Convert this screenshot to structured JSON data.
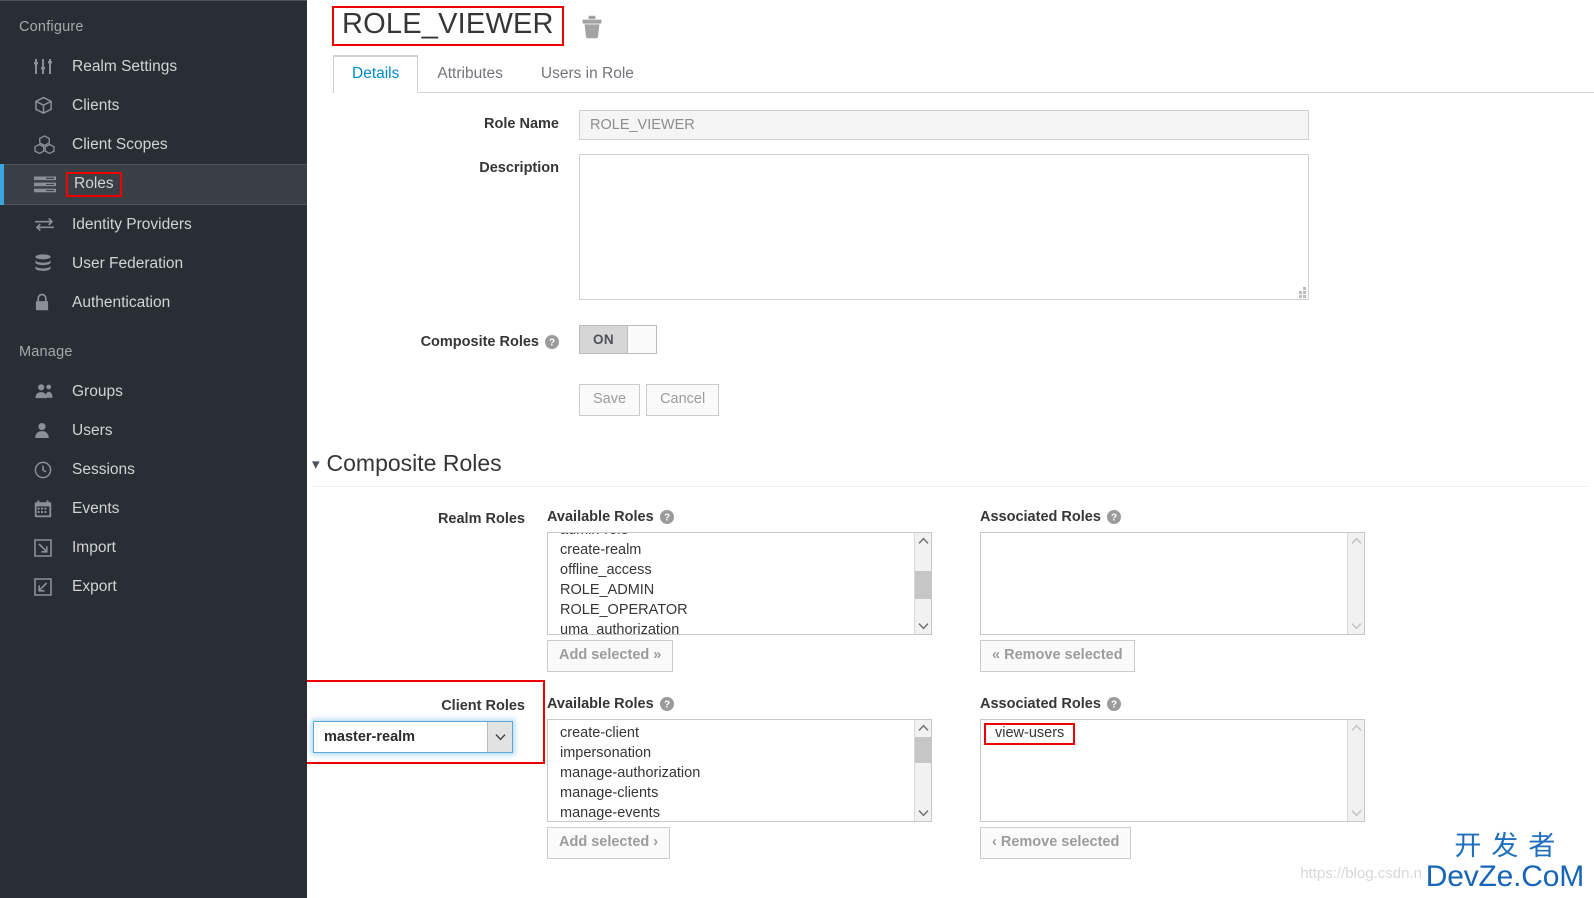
{
  "sidebar": {
    "groups": [
      {
        "title": "Configure",
        "items": [
          {
            "label": "Realm Settings",
            "icon": "sliders-icon",
            "active": false
          },
          {
            "label": "Clients",
            "icon": "cube-icon",
            "active": false
          },
          {
            "label": "Client Scopes",
            "icon": "cubes-icon",
            "active": false
          },
          {
            "label": "Roles",
            "icon": "list-rows-icon",
            "active": true
          },
          {
            "label": "Identity Providers",
            "icon": "exchange-icon",
            "active": false
          },
          {
            "label": "User Federation",
            "icon": "database-icon",
            "active": false
          },
          {
            "label": "Authentication",
            "icon": "lock-icon",
            "active": false
          }
        ]
      },
      {
        "title": "Manage",
        "items": [
          {
            "label": "Groups",
            "icon": "users-icon",
            "active": false
          },
          {
            "label": "Users",
            "icon": "user-icon",
            "active": false
          },
          {
            "label": "Sessions",
            "icon": "clock-icon",
            "active": false
          },
          {
            "label": "Events",
            "icon": "calendar-icon",
            "active": false
          },
          {
            "label": "Import",
            "icon": "import-arrow-icon",
            "active": false
          },
          {
            "label": "Export",
            "icon": "export-arrow-icon",
            "active": false
          }
        ]
      }
    ]
  },
  "header": {
    "title": "ROLE_VIEWER",
    "delete_icon": "trash-icon"
  },
  "tabs": [
    {
      "label": "Details",
      "active": true
    },
    {
      "label": "Attributes",
      "active": false
    },
    {
      "label": "Users in Role",
      "active": false
    }
  ],
  "details": {
    "role_name_label": "Role Name",
    "role_name_value": "ROLE_VIEWER",
    "description_label": "Description",
    "description_value": "",
    "composite_label": "Composite Roles",
    "composite_toggle_state": "ON",
    "save_label": "Save",
    "cancel_label": "Cancel"
  },
  "composite_section": {
    "title": "Composite Roles",
    "realm": {
      "row_label": "Realm Roles",
      "available_label": "Available Roles",
      "available_items": [
        "admin-role",
        "create-realm",
        "offline_access",
        "ROLE_ADMIN",
        "ROLE_OPERATOR",
        "uma_authorization"
      ],
      "add_button": "Add selected »",
      "associated_label": "Associated Roles",
      "associated_items": [],
      "remove_button": "« Remove selected"
    },
    "client": {
      "row_label": "Client Roles",
      "select_value": "master-realm",
      "available_label": "Available Roles",
      "available_items": [
        "create-client",
        "impersonation",
        "manage-authorization",
        "manage-clients",
        "manage-events"
      ],
      "add_button": "Add selected ›",
      "associated_label": "Associated Roles",
      "associated_items": [
        "view-users"
      ],
      "remove_button": "‹ Remove selected"
    }
  },
  "watermark": {
    "url": "https://blog.csdn.n",
    "cn": "开发者",
    "en": "DevZe.CoM"
  },
  "colors": {
    "sidebar_bg": "#292e34",
    "accent_blue": "#39a5dc",
    "tab_active": "#0088ce",
    "highlight_red": "#ee0000"
  }
}
